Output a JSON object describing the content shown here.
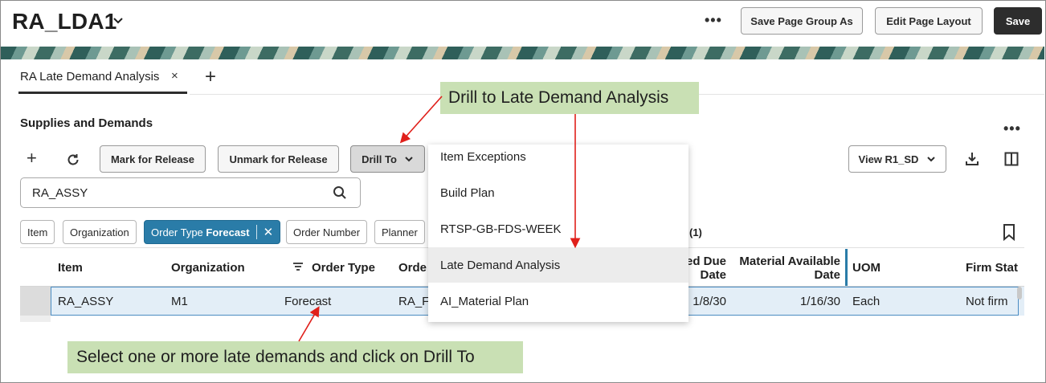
{
  "header": {
    "title": "RA_LDA1",
    "more_label": "•••",
    "save_page_group_as_label": "Save Page Group As",
    "edit_page_layout_label": "Edit Page Layout",
    "save_label": "Save"
  },
  "tabs": [
    {
      "label": "RA Late Demand Analysis",
      "close": "×"
    }
  ],
  "tab_add": "+",
  "section": {
    "title": "Supplies and Demands",
    "more_label": "•••"
  },
  "toolbar": {
    "add": "+",
    "mark_for_release_label": "Mark for Release",
    "unmark_for_release_label": "Unmark for Release",
    "drill_to_label": "Drill To",
    "view_label": "View R1_SD"
  },
  "search": {
    "value": "RA_ASSY"
  },
  "filters": {
    "chips": [
      "Item",
      "Organization"
    ],
    "active_chip_prefix": "Order Type",
    "active_chip_value": "Forecast",
    "chips_after": [
      "Order Number",
      "Planner"
    ],
    "result_count": "(1)"
  },
  "table": {
    "headers": {
      "item": "Item",
      "organization": "Organization",
      "order_type": "Order Type",
      "order_number": "Orde",
      "due_date_line1": "ed Due",
      "due_date_line2": "Date",
      "material_available_line1": "Material Available",
      "material_available_line2": "Date",
      "uom": "UOM",
      "firm_status": "Firm Stat"
    },
    "rows": [
      {
        "item": "RA_ASSY",
        "organization": "M1",
        "order_type": "Forecast",
        "order_number": "RA_F",
        "due_date": "1/8/30",
        "material_available": "1/16/30",
        "uom": "Each",
        "firm_status": "Not firm"
      }
    ]
  },
  "drill_menu": {
    "items": [
      "Item Exceptions",
      "Build Plan",
      "RTSP-GB-FDS-WEEK",
      "Late Demand Analysis",
      "AI_Material Plan"
    ],
    "highlighted": "Late Demand Analysis"
  },
  "callouts": {
    "top": "Drill to Late Demand Analysis",
    "bottom": "Select one or more late demands and click on Drill To"
  },
  "colors": {
    "accent": "#2a7ca8",
    "callout_bg": "#c9e0b4",
    "arrow": "#e0201b",
    "save_button": "#2d2d2d"
  }
}
